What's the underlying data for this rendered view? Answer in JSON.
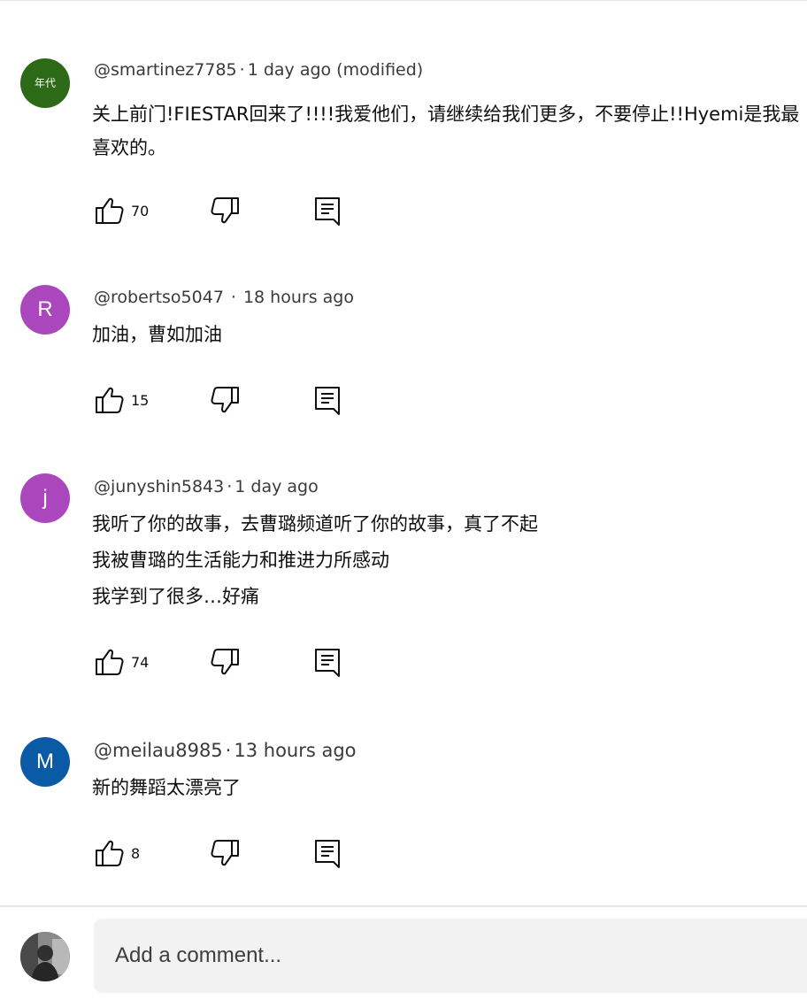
{
  "comments": [
    {
      "avatar_text": "年代",
      "avatar_color": "#2d6a18",
      "handle": "@smartinez7785",
      "separator": "·",
      "time": "1 day ago (modified)",
      "lines": [
        "关上前门!FIESTAR回来了!!!!我爱他们，请继续给我们更多，不要停止!!Hyemi是我最喜欢的。"
      ],
      "likes": "70"
    },
    {
      "avatar_text": "R",
      "avatar_color": "#ab47bc",
      "handle": "@robertso5047",
      "separator": "·",
      "time": "18 hours ago",
      "lines": [
        "加油，曹如加油"
      ],
      "likes": "15"
    },
    {
      "avatar_text": "j",
      "avatar_color": "#ab47bc",
      "handle": "@junyshin5843",
      "separator": "·",
      "time": "1 day ago",
      "lines": [
        "我听了你的故事，去曹璐频道听了你的故事，真了不起",
        "我被曹璐的生活能力和推进力所感动",
        "我学到了很多…好痛"
      ],
      "likes": "74"
    },
    {
      "avatar_text": "M",
      "avatar_color": "#0b5aa6",
      "handle": "@meilau8985",
      "separator": "·",
      "time": "13 hours ago",
      "lines": [
        "新的舞蹈太漂亮了"
      ],
      "likes": "8"
    }
  ],
  "icons": {
    "like": "thumbs-up-icon",
    "dislike": "thumbs-down-icon",
    "reply": "reply-comment-icon"
  },
  "composer": {
    "placeholder": "Add a comment..."
  }
}
